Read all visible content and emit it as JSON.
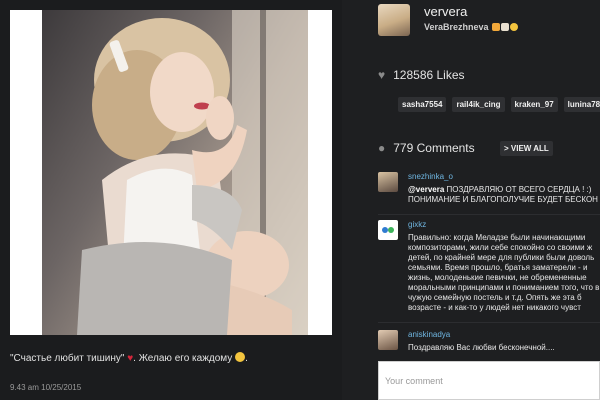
{
  "post": {
    "caption_text": "\"Счастье любит тишину\" ",
    "caption_rest": ". Желаю его каждому ",
    "timestamp": "9.43 am 10/25/2015"
  },
  "profile": {
    "username": "ververa",
    "full_name": "VeraBrezhneva"
  },
  "likes": {
    "count_label": "128586 Likes",
    "tags": [
      "sasha7554",
      "rail4ik_cing",
      "kraken_97",
      "lunina783"
    ]
  },
  "comments": {
    "count_label": "779 Comments",
    "view_all_label": "> VIEW ALL",
    "items": [
      {
        "user": "snezhinka_o",
        "mention": "@ververa",
        "text": " ПОЗДРАВЛЯЮ ОТ ВСЕГО СЕРДЦА ! :) ПОНИМАНИЕ И БЛАГОПОЛУЧИЕ БУДЕТ БЕСКОН"
      },
      {
        "user": "gixkz",
        "mention": "",
        "text": "Правильно: когда Меладзе были начинающими композиторами, жили себе спокойно со своими ж детей, по крайней мере для публики были доволь семьями. Время прошло, братья заматерели - и жизнь, молоденькие певички, не обремененные моральными принципами и пониманием того, что в чужую семейную постель и т.д. Опять же эта б возрасте - и как-то у людей нет никакого чувст"
      },
      {
        "user": "aniskinadya",
        "mention": "",
        "text": "Поздравляю Вас любви бесконечной...."
      }
    ]
  },
  "comment_input": {
    "placeholder": "Your comment"
  },
  "colors": {
    "background": "#1e1f21",
    "username_link": "#6fb5e0",
    "tag_bg": "#2f3033"
  }
}
